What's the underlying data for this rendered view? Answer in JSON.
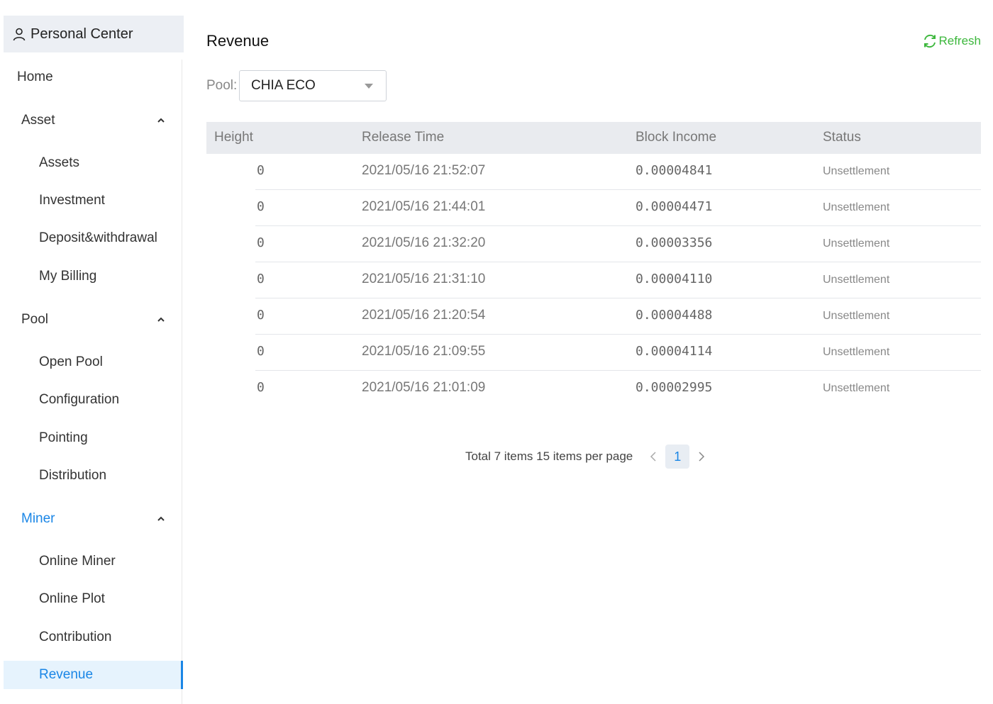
{
  "sidebar": {
    "header": "Personal Center",
    "items": [
      {
        "label": "Home",
        "level": "top"
      },
      {
        "label": "Asset",
        "level": "group"
      },
      {
        "label": "Assets",
        "level": "sub"
      },
      {
        "label": "Investment",
        "level": "sub"
      },
      {
        "label": "Deposit&withdrawal",
        "level": "sub"
      },
      {
        "label": "My Billing",
        "level": "sub"
      },
      {
        "label": "Pool",
        "level": "group"
      },
      {
        "label": "Open Pool",
        "level": "sub"
      },
      {
        "label": "Configuration",
        "level": "sub"
      },
      {
        "label": "Pointing",
        "level": "sub"
      },
      {
        "label": "Distribution",
        "level": "sub"
      },
      {
        "label": "Miner",
        "level": "group",
        "active": true
      },
      {
        "label": "Online Miner",
        "level": "sub"
      },
      {
        "label": "Online Plot",
        "level": "sub"
      },
      {
        "label": "Contribution",
        "level": "sub"
      },
      {
        "label": "Revenue",
        "level": "sub",
        "selected": true
      }
    ]
  },
  "main": {
    "title": "Revenue",
    "refresh_label": "Refresh",
    "pool_label": "Pool:",
    "pool_value": "CHIA ECO"
  },
  "table": {
    "columns": [
      "Height",
      "Release Time",
      "Block Income",
      "Status"
    ],
    "rows": [
      {
        "height": "0",
        "time": "2021/05/16 21:52:07",
        "income": "0.00004841",
        "status": "Unsettlement"
      },
      {
        "height": "0",
        "time": "2021/05/16 21:44:01",
        "income": "0.00004471",
        "status": "Unsettlement"
      },
      {
        "height": "0",
        "time": "2021/05/16 21:32:20",
        "income": "0.00003356",
        "status": "Unsettlement"
      },
      {
        "height": "0",
        "time": "2021/05/16 21:31:10",
        "income": "0.00004110",
        "status": "Unsettlement"
      },
      {
        "height": "0",
        "time": "2021/05/16 21:20:54",
        "income": "0.00004488",
        "status": "Unsettlement"
      },
      {
        "height": "0",
        "time": "2021/05/16 21:09:55",
        "income": "0.00004114",
        "status": "Unsettlement"
      },
      {
        "height": "0",
        "time": "2021/05/16 21:01:09",
        "income": "0.00002995",
        "status": "Unsettlement"
      }
    ]
  },
  "pagination": {
    "total_text": "Total 7 items 15 items per page",
    "current_page": "1"
  },
  "colors": {
    "accent": "#1a86e6",
    "refresh": "#3cb73c",
    "selected_bg": "#e6f3fd"
  }
}
